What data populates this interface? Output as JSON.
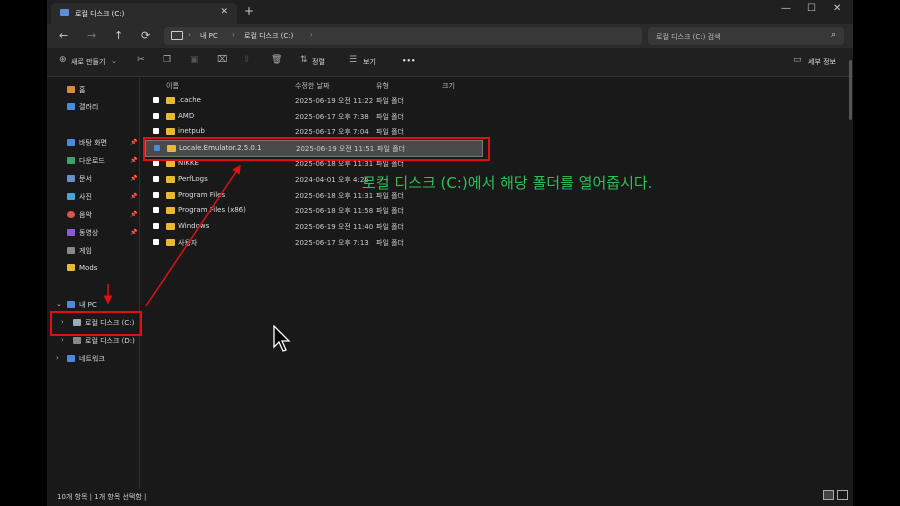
{
  "tab": {
    "title": "로컬 디스크 (C:)",
    "close": "✕",
    "new": "+"
  },
  "window_controls": {
    "minimize": "—",
    "maximize": "☐",
    "close": "✕"
  },
  "nav": {
    "back": "←",
    "forward": "→",
    "up": "↑",
    "refresh": "⟳"
  },
  "address": {
    "crumbs": [
      "내 PC",
      "로컬 디스크 (C:)"
    ],
    "sep": "›"
  },
  "search": {
    "placeholder": "로컬 디스크 (C:) 검색",
    "icon": "⌕"
  },
  "toolbar": {
    "new": "새로 만들기",
    "sort": "정렬",
    "view": "보기",
    "more": "•••",
    "details": "세부 정보"
  },
  "sidebar": {
    "home": "홈",
    "gallery": "갤러리",
    "quick": [
      "바탕 화면",
      "다운로드",
      "문서",
      "사진",
      "음악",
      "동영상",
      "게임",
      "Mods"
    ],
    "this_pc": "내 PC",
    "drive_c": "로컬 디스크 (C:)",
    "drive_d": "로컬 디스크 (D:)",
    "network": "네트워크"
  },
  "columns": {
    "name": "이름",
    "date": "수정한 날짜",
    "type": "유형",
    "size": "크기"
  },
  "files": [
    {
      "name": ".cache",
      "date": "2025-06-19 오전 11:22",
      "type": "파일 폴더"
    },
    {
      "name": "AMD",
      "date": "2025-06-17 오후 7:38",
      "type": "파일 폴더"
    },
    {
      "name": "inetpub",
      "date": "2025-06-17 오후 7:04",
      "type": "파일 폴더"
    },
    {
      "name": "Locale.Emulator.2.5.0.1",
      "date": "2025-06-19 오전 11:51",
      "type": "파일 폴더"
    },
    {
      "name": "NIKKE",
      "date": "2025-06-18 오후 11:31",
      "type": "파일 폴더"
    },
    {
      "name": "PerfLogs",
      "date": "2024-04-01 오후 4:26",
      "type": ""
    },
    {
      "name": "Program Files",
      "date": "2025-06-18 오후 11:31",
      "type": "파일 폴더"
    },
    {
      "name": "Program Files (x86)",
      "date": "2025-06-18 오후 11:58",
      "type": "파일 폴더"
    },
    {
      "name": "Windows",
      "date": "2025-06-19 오전 11:40",
      "type": "파일 폴더"
    },
    {
      "name": "사용자",
      "date": "2025-06-17 오후 7:13",
      "type": "파일 폴더"
    }
  ],
  "status": "10개 항목  |  1개 항목 선택함  |",
  "annotation": "로컬 디스크 (C:)에서 해당 폴더를 열어줍시다.",
  "colors": {
    "accent": "#4a8ad8",
    "folder": "#e8b83b",
    "annotation": "#2ec05a",
    "highlight": "#d11111"
  }
}
